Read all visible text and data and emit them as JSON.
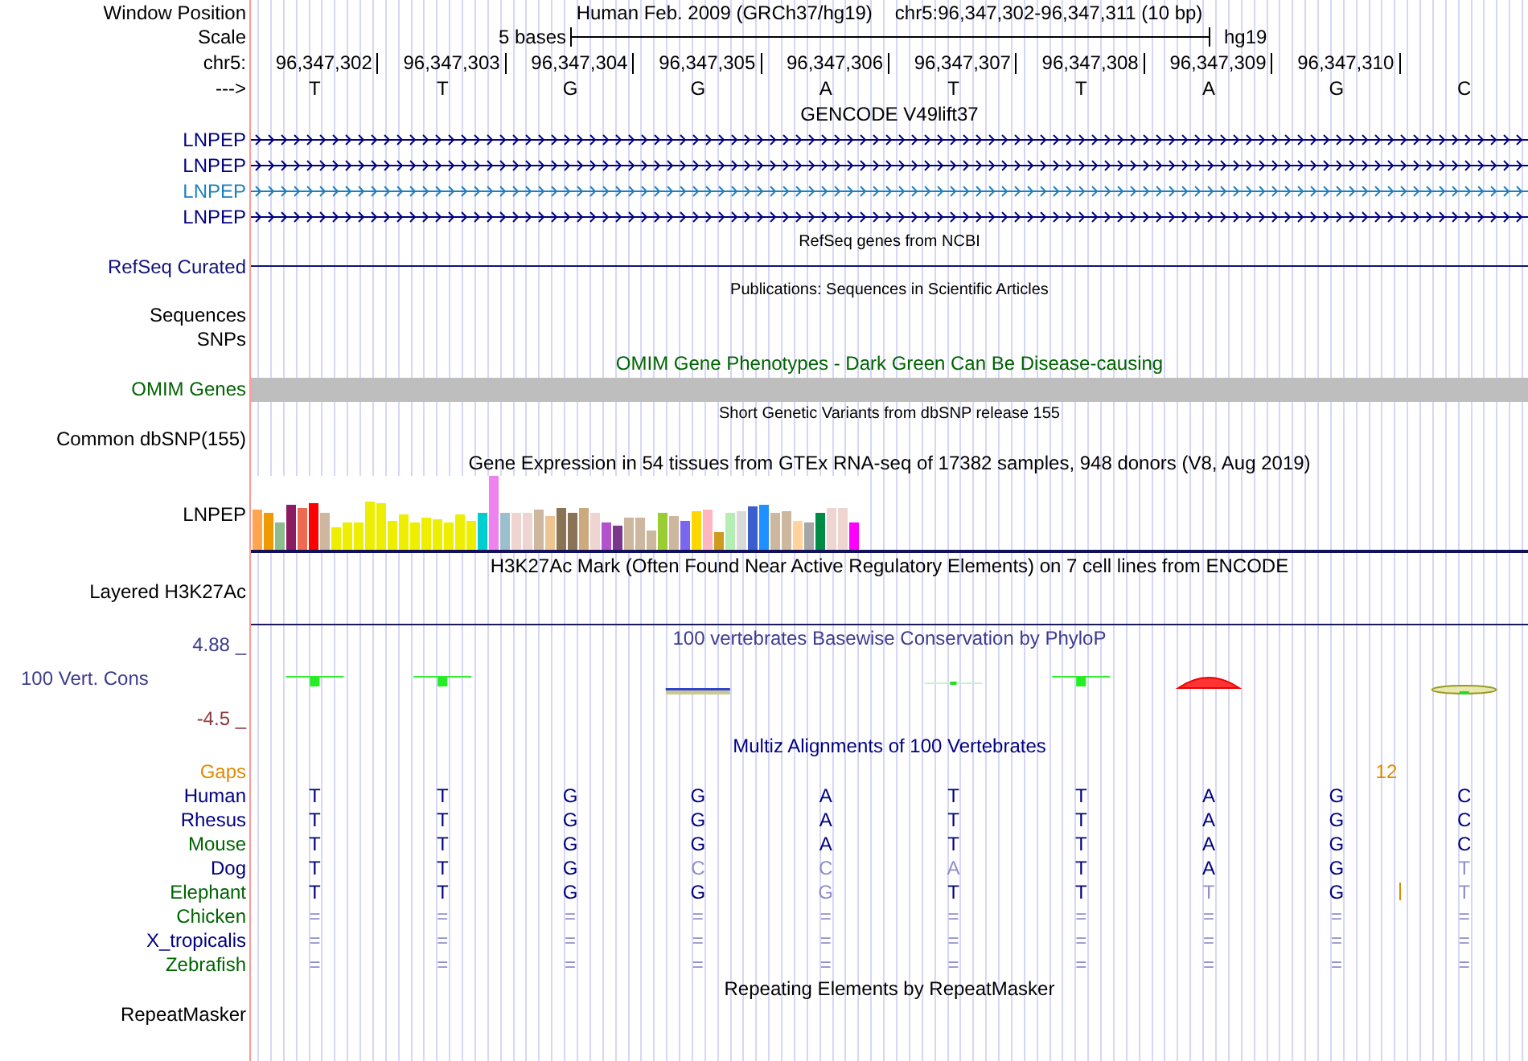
{
  "header": {
    "label": "Window Position",
    "assembly": "Human Feb. 2009 (GRCh37/hg19)",
    "position": "chr5:96,347,302-96,347,311 (10 bp)"
  },
  "scale": {
    "label": "Scale",
    "text": "5 bases",
    "assembly": "hg19"
  },
  "ruler": {
    "label": "chr5:",
    "positions": [
      "96,347,302",
      "96,347,303",
      "96,347,304",
      "96,347,305",
      "96,347,306",
      "96,347,307",
      "96,347,308",
      "96,347,309",
      "96,347,310"
    ]
  },
  "bases": {
    "label": "--->",
    "values": [
      "T",
      "T",
      "G",
      "G",
      "A",
      "T",
      "T",
      "A",
      "G",
      "C"
    ]
  },
  "tracks": [
    {
      "kind": "gene",
      "title": "GENCODE V49lift37",
      "color": "#000000",
      "rows": [
        {
          "label": "LNPEP",
          "color": "#000080"
        },
        {
          "label": "LNPEP",
          "color": "#000080"
        },
        {
          "label": "LNPEP",
          "color": "#1e7fc0"
        },
        {
          "label": "LNPEP",
          "color": "#000080"
        }
      ]
    },
    {
      "kind": "line",
      "title": "RefSeq genes from NCBI",
      "color": "#000000",
      "labels": [
        {
          "text": "RefSeq Curated",
          "color": "#12127a"
        }
      ]
    },
    {
      "kind": "dense",
      "title": "Publications: Sequences in Scientific Articles",
      "color": "#000000",
      "labels": [
        {
          "text": "Sequences",
          "color": "#000000"
        },
        {
          "text": "SNPs",
          "color": "#000000"
        }
      ]
    },
    {
      "kind": "bar",
      "title": "OMIM Gene Phenotypes - Dark Green Can Be Disease-causing",
      "color": "#006400",
      "labels": [
        {
          "text": "OMIM Genes",
          "color": "#006400"
        }
      ]
    },
    {
      "kind": "dense",
      "title": "Short Genetic Variants from dbSNP release 155",
      "color": "#000000",
      "labels": [
        {
          "text": "Common dbSNP(155)",
          "color": "#000000"
        }
      ]
    },
    {
      "kind": "gtex",
      "title": "Gene Expression in 54 tissues from GTEx RNA-seq of 17382 samples, 948 donors (V8, Aug 2019)",
      "color": "#000000",
      "labels": [
        {
          "text": "LNPEP",
          "color": "#000000"
        }
      ],
      "bars": [
        {
          "color": "#ffa54f",
          "level": 0.55
        },
        {
          "color": "#ee9a00",
          "level": 0.5
        },
        {
          "color": "#8fbc8f",
          "level": 0.38
        },
        {
          "color": "#8b1c62",
          "level": 0.6
        },
        {
          "color": "#ee6a50",
          "level": 0.56
        },
        {
          "color": "#ff0000",
          "level": 0.62
        },
        {
          "color": "#cdb79e",
          "level": 0.5
        },
        {
          "color": "#eeee00",
          "level": 0.3
        },
        {
          "color": "#eeee00",
          "level": 0.38
        },
        {
          "color": "#eeee00",
          "level": 0.38
        },
        {
          "color": "#eeee00",
          "level": 0.66
        },
        {
          "color": "#eeee00",
          "level": 0.62
        },
        {
          "color": "#eeee00",
          "level": 0.4
        },
        {
          "color": "#eeee00",
          "level": 0.48
        },
        {
          "color": "#eeee00",
          "level": 0.38
        },
        {
          "color": "#eeee00",
          "level": 0.44
        },
        {
          "color": "#eeee00",
          "level": 0.42
        },
        {
          "color": "#eeee00",
          "level": 0.38
        },
        {
          "color": "#eeee00",
          "level": 0.48
        },
        {
          "color": "#eeee00",
          "level": 0.4
        },
        {
          "color": "#00cdcd",
          "level": 0.5
        },
        {
          "color": "#ee82ee",
          "level": 1.0
        },
        {
          "color": "#9ac0cd",
          "level": 0.5
        },
        {
          "color": "#eed5d2",
          "level": 0.5
        },
        {
          "color": "#eed5d2",
          "level": 0.5
        },
        {
          "color": "#cdb79e",
          "level": 0.54
        },
        {
          "color": "#eec591",
          "level": 0.46
        },
        {
          "color": "#8b7355",
          "level": 0.56
        },
        {
          "color": "#8b7355",
          "level": 0.5
        },
        {
          "color": "#cdaa7d",
          "level": 0.56
        },
        {
          "color": "#eed5d2",
          "level": 0.5
        },
        {
          "color": "#b452cd",
          "level": 0.38
        },
        {
          "color": "#7a378b",
          "level": 0.32
        },
        {
          "color": "#cdb79e",
          "level": 0.44
        },
        {
          "color": "#cdb79e",
          "level": 0.44
        },
        {
          "color": "#cdb79e",
          "level": 0.26
        },
        {
          "color": "#9acd32",
          "level": 0.5
        },
        {
          "color": "#cdb79e",
          "level": 0.46
        },
        {
          "color": "#7a67ee",
          "level": 0.4
        },
        {
          "color": "#ffd700",
          "level": 0.52
        },
        {
          "color": "#ffb6c1",
          "level": 0.54
        },
        {
          "color": "#cd9b1d",
          "level": 0.25
        },
        {
          "color": "#b4eeb4",
          "level": 0.5
        },
        {
          "color": "#d9d9d9",
          "level": 0.52
        },
        {
          "color": "#3a5fcd",
          "level": 0.58
        },
        {
          "color": "#1e90ff",
          "level": 0.6
        },
        {
          "color": "#cdb79e",
          "level": 0.5
        },
        {
          "color": "#cdb79e",
          "level": 0.52
        },
        {
          "color": "#ffd39b",
          "level": 0.4
        },
        {
          "color": "#a6a6a6",
          "level": 0.36
        },
        {
          "color": "#008b45",
          "level": 0.5
        },
        {
          "color": "#eed5d2",
          "level": 0.56
        },
        {
          "color": "#eed5d2",
          "level": 0.56
        },
        {
          "color": "#ff00ff",
          "level": 0.36
        }
      ]
    },
    {
      "kind": "signal",
      "title": "H3K27Ac Mark (Often Found Near Active Regulatory Elements) on 7 cell lines from ENCODE",
      "color": "#000000",
      "labels": [
        {
          "text": "Layered H3K27Ac",
          "color": "#000000"
        }
      ]
    },
    {
      "kind": "conservation",
      "title": "100 vertebrates Basewise Conservation by PhyloP",
      "color": "#3c3c8c",
      "labels": [
        {
          "text": "100 Vert. Cons",
          "color": "#3c3c8c"
        }
      ],
      "max": "4.88 _",
      "min": "-4.5 _"
    },
    {
      "kind": "multiz",
      "title": "Multiz Alignments of 100 Vertebrates",
      "color": "#000080",
      "gaps": {
        "label": "Gaps",
        "value": "12"
      },
      "species": [
        {
          "name": "Human",
          "color": "#000080",
          "bases": [
            {
              "b": "T",
              "faint": false
            },
            {
              "b": "T",
              "faint": false
            },
            {
              "b": "G",
              "faint": false
            },
            {
              "b": "G",
              "faint": false
            },
            {
              "b": "A",
              "faint": false
            },
            {
              "b": "T",
              "faint": false
            },
            {
              "b": "T",
              "faint": false
            },
            {
              "b": "A",
              "faint": false
            },
            {
              "b": "G",
              "faint": false
            },
            {
              "b": "C",
              "faint": false
            }
          ]
        },
        {
          "name": "Rhesus",
          "color": "#000080",
          "bases": [
            {
              "b": "T",
              "faint": false
            },
            {
              "b": "T",
              "faint": false
            },
            {
              "b": "G",
              "faint": false
            },
            {
              "b": "G",
              "faint": false
            },
            {
              "b": "A",
              "faint": false
            },
            {
              "b": "T",
              "faint": false
            },
            {
              "b": "T",
              "faint": false
            },
            {
              "b": "A",
              "faint": false
            },
            {
              "b": "G",
              "faint": false
            },
            {
              "b": "C",
              "faint": false
            }
          ]
        },
        {
          "name": "Mouse",
          "color": "#006400",
          "bases": [
            {
              "b": "T",
              "faint": false
            },
            {
              "b": "T",
              "faint": false
            },
            {
              "b": "G",
              "faint": false
            },
            {
              "b": "G",
              "faint": false
            },
            {
              "b": "A",
              "faint": false
            },
            {
              "b": "T",
              "faint": false
            },
            {
              "b": "T",
              "faint": false
            },
            {
              "b": "A",
              "faint": false
            },
            {
              "b": "G",
              "faint": false
            },
            {
              "b": "C",
              "faint": false
            }
          ]
        },
        {
          "name": "Dog",
          "color": "#000080",
          "bases": [
            {
              "b": "T",
              "faint": false
            },
            {
              "b": "T",
              "faint": false
            },
            {
              "b": "G",
              "faint": false
            },
            {
              "b": "C",
              "faint": true
            },
            {
              "b": "C",
              "faint": true
            },
            {
              "b": "A",
              "faint": true
            },
            {
              "b": "T",
              "faint": false
            },
            {
              "b": "A",
              "faint": false
            },
            {
              "b": "G",
              "faint": false
            },
            {
              "b": "T",
              "faint": true
            }
          ]
        },
        {
          "name": "Elephant",
          "color": "#006400",
          "bases": [
            {
              "b": "T",
              "faint": false
            },
            {
              "b": "T",
              "faint": false
            },
            {
              "b": "G",
              "faint": false
            },
            {
              "b": "G",
              "faint": false
            },
            {
              "b": "G",
              "faint": true
            },
            {
              "b": "T",
              "faint": false
            },
            {
              "b": "T",
              "faint": false
            },
            {
              "b": "T",
              "faint": true
            },
            {
              "b": "G",
              "faint": false,
              "insert": true
            },
            {
              "b": "T",
              "faint": true
            }
          ]
        },
        {
          "name": "Chicken",
          "color": "#006400",
          "bases": [
            {
              "b": "=",
              "faint": true
            },
            {
              "b": "=",
              "faint": true
            },
            {
              "b": "=",
              "faint": true
            },
            {
              "b": "=",
              "faint": true
            },
            {
              "b": "=",
              "faint": true
            },
            {
              "b": "=",
              "faint": true
            },
            {
              "b": "=",
              "faint": true
            },
            {
              "b": "=",
              "faint": true
            },
            {
              "b": "=",
              "faint": true
            },
            {
              "b": "=",
              "faint": true
            }
          ]
        },
        {
          "name": "X_tropicalis",
          "color": "#000080",
          "bases": [
            {
              "b": "=",
              "faint": true
            },
            {
              "b": "=",
              "faint": true
            },
            {
              "b": "=",
              "faint": true
            },
            {
              "b": "=",
              "faint": true
            },
            {
              "b": "=",
              "faint": true
            },
            {
              "b": "=",
              "faint": true
            },
            {
              "b": "=",
              "faint": true
            },
            {
              "b": "=",
              "faint": true
            },
            {
              "b": "=",
              "faint": true
            },
            {
              "b": "=",
              "faint": true
            }
          ]
        },
        {
          "name": "Zebrafish",
          "color": "#006400",
          "bases": [
            {
              "b": "=",
              "faint": true
            },
            {
              "b": "=",
              "faint": true
            },
            {
              "b": "=",
              "faint": true
            },
            {
              "b": "=",
              "faint": true
            },
            {
              "b": "=",
              "faint": true
            },
            {
              "b": "=",
              "faint": true
            },
            {
              "b": "=",
              "faint": true
            },
            {
              "b": "=",
              "faint": true
            },
            {
              "b": "=",
              "faint": true
            },
            {
              "b": "=",
              "faint": true
            }
          ]
        }
      ]
    },
    {
      "kind": "empty",
      "title": "Repeating Elements by RepeatMasker",
      "color": "#000000",
      "labels": [
        {
          "text": "RepeatMasker",
          "color": "#000000"
        }
      ]
    }
  ]
}
